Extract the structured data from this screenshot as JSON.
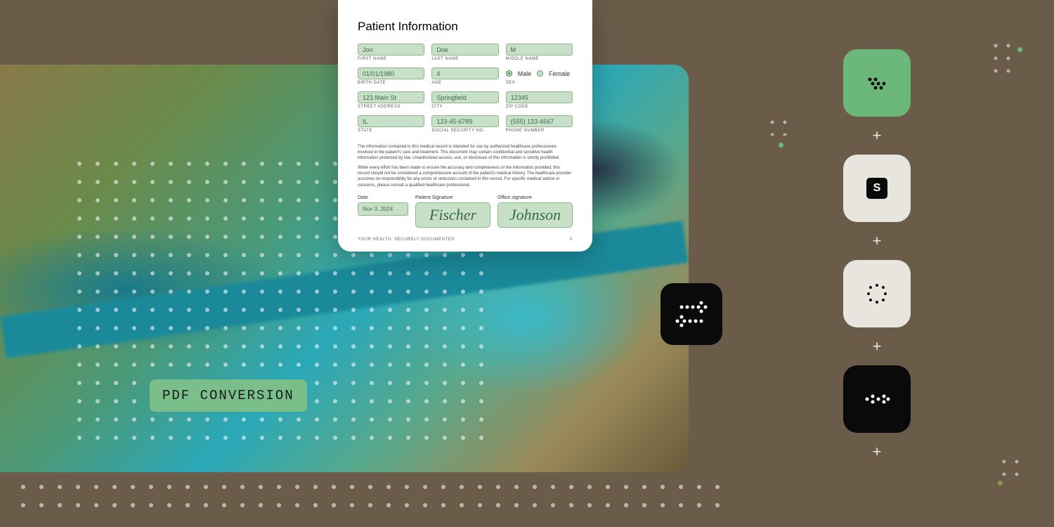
{
  "badge_label": "PDF CONVERSION",
  "document": {
    "title": "Patient Information",
    "fields": {
      "first_name": {
        "value": "Jon",
        "label": "FIRST NAME"
      },
      "last_name": {
        "value": "Doe",
        "label": "LAST NAME"
      },
      "middle_name": {
        "value": "M",
        "label": "MIDDLE NAME"
      },
      "birth_date": {
        "value": "01/01/1980",
        "label": "BIRTH DATE"
      },
      "age": {
        "value": "4",
        "label": "AGE"
      },
      "sex": {
        "label": "SEX",
        "options": [
          "Male",
          "Female"
        ],
        "selected": "Male"
      },
      "street": {
        "value": "123 Main St",
        "label": "STREET ADDRESS"
      },
      "city": {
        "value": "Springfield",
        "label": "CITY"
      },
      "zip": {
        "value": "12345",
        "label": "ZIP CODE"
      },
      "state": {
        "value": "IL",
        "label": "STATE"
      },
      "ssn": {
        "value": "123-45-6789",
        "label": "SOCIAL SECURITY NO."
      },
      "phone": {
        "value": "(555) 123-4567",
        "label": "PHONE NUMBER"
      }
    },
    "legal_1": "The information contained in this medical record is intended for use by authorized healthcare professionals involved in the patient's care and treatment. This document may contain confidential and sensitive health information protected by law. Unauthorized access, use, or disclosure of this information is strictly prohibited.",
    "legal_2": "While every effort has been made to ensure the accuracy and completeness of the information provided, this record should not be considered a comprehensive account of the patient's medical history. The healthcare provider assumes no responsibility for any errors or omissions contained in this record. For specific medical advice or concerns, please consult a qualified healthcare professional.",
    "date": {
      "label": "Date",
      "value": "Nov 3, 2024"
    },
    "patient_sig": {
      "label": "Patient Signature",
      "value": "Fischer"
    },
    "office_sig": {
      "label": "Office signature",
      "value": "Johnson"
    },
    "footer_left": "YOUR HEALTH, SECURELY DOCUMENTED",
    "footer_right": "0"
  },
  "tiles": {
    "s_label": "S"
  },
  "colors": {
    "green": "#6bb87a",
    "olive": "#8a9a4a"
  }
}
